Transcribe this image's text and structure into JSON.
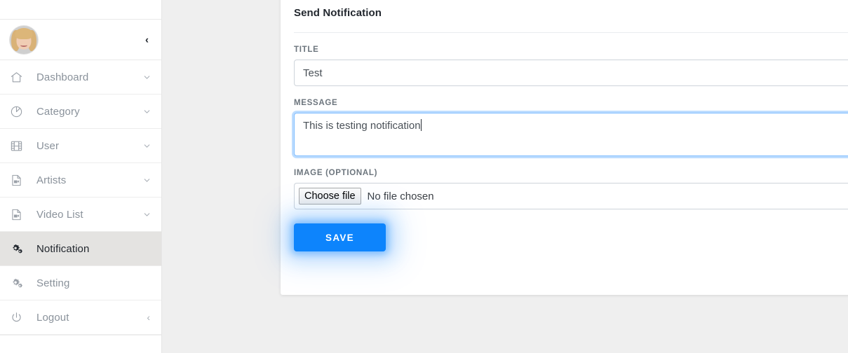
{
  "sidebar": {
    "collapse_toggle": "‹",
    "profile": {
      "avatar_alt": "user avatar"
    },
    "items": [
      {
        "label": "Dashboard",
        "icon": "home-icon",
        "has_chevron": true,
        "active": false
      },
      {
        "label": "Category",
        "icon": "pie-chart-icon",
        "has_chevron": true,
        "active": false
      },
      {
        "label": "User",
        "icon": "film-strip-icon",
        "has_chevron": true,
        "active": false
      },
      {
        "label": "Artists",
        "icon": "video-file-icon",
        "has_chevron": true,
        "active": false
      },
      {
        "label": "Video List",
        "icon": "video-file-icon",
        "has_chevron": true,
        "active": false
      },
      {
        "label": "Notification",
        "icon": "cogs-icon",
        "has_chevron": false,
        "active": true
      },
      {
        "label": "Setting",
        "icon": "cogs-icon",
        "has_chevron": false,
        "active": false
      },
      {
        "label": "Logout",
        "icon": "power-icon",
        "has_chevron": false,
        "active": false,
        "chevron_left": "‹"
      }
    ]
  },
  "card": {
    "title": "Send Notification",
    "fields": {
      "title": {
        "label": "TITLE",
        "value": "Test",
        "placeholder": ""
      },
      "message": {
        "label": "MESSAGE",
        "value": "This is testing notification",
        "placeholder": "",
        "focused": true
      },
      "image": {
        "label": "IMAGE (OPTIONAL)",
        "button_label": "Choose file",
        "status_text": "No file chosen"
      }
    },
    "save_label": "SAVE"
  },
  "colors": {
    "accent": "#0d84fc",
    "focus_border": "#80bdff",
    "page_background": "#efefef",
    "sidebar_active": "#e4e3e1",
    "label_text": "#6c757d",
    "menu_text": "#8a929b"
  }
}
